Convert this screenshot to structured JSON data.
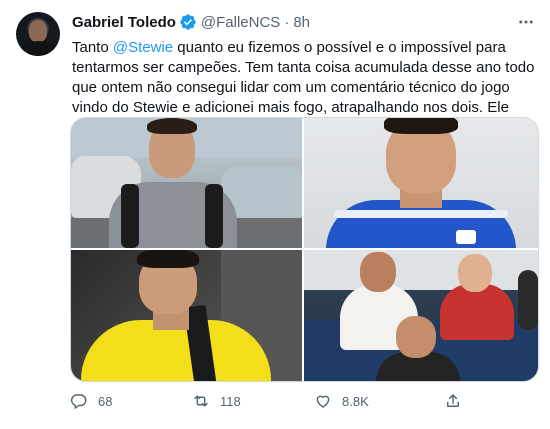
{
  "author": {
    "name": "Gabriel Toledo",
    "handle": "@FalleNCS",
    "separator": "·",
    "time": "8h"
  },
  "tweet": {
    "text_before_mention": "Tanto ",
    "mention": "@Stewie",
    "text_after_mention": " quanto eu fizemos o possível e o impossível para tentarmos ser campeões. Tem tanta coisa acumulada desse ano todo que ontem não consegui lidar com um comentário técnico do jogo vindo do Stewie e adicionei mais fogo, atrapalhando nos dois. Ele merece o carinho de vcs"
  },
  "media": {
    "photo_count": 4
  },
  "actions": {
    "reply_count": "68",
    "retweet_count": "118",
    "like_count": "8.8K"
  },
  "icons": {
    "verified": "verified-badge-icon",
    "more": "more-options-icon",
    "reply": "reply-icon",
    "retweet": "retweet-icon",
    "like": "like-icon",
    "share": "share-icon"
  },
  "colors": {
    "accent": "#1d9bf0",
    "text_primary": "#0f1419",
    "text_secondary": "#536471",
    "border": "#cfd9de"
  }
}
